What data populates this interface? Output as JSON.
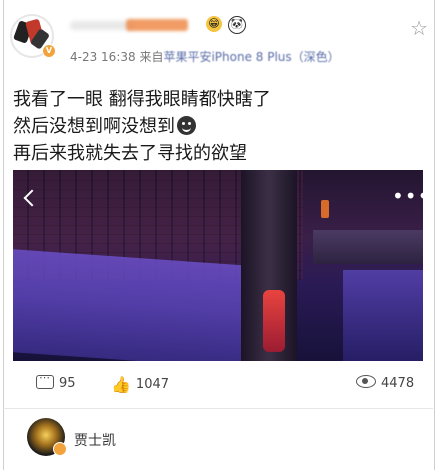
{
  "post": {
    "meta_prefix": "4-23 16:38  来自",
    "meta_source": "苹果平安iPhone 8 Plus（深色）",
    "lines": [
      "我看了一眼 翻得我眼睛都快瞎了",
      "然后没想到啊没想到",
      "再后来我就失去了寻找的欲望"
    ]
  },
  "actions": {
    "comments": "95",
    "likes": "1047",
    "views": "4478"
  },
  "commenter": {
    "name": "贾士凯"
  }
}
